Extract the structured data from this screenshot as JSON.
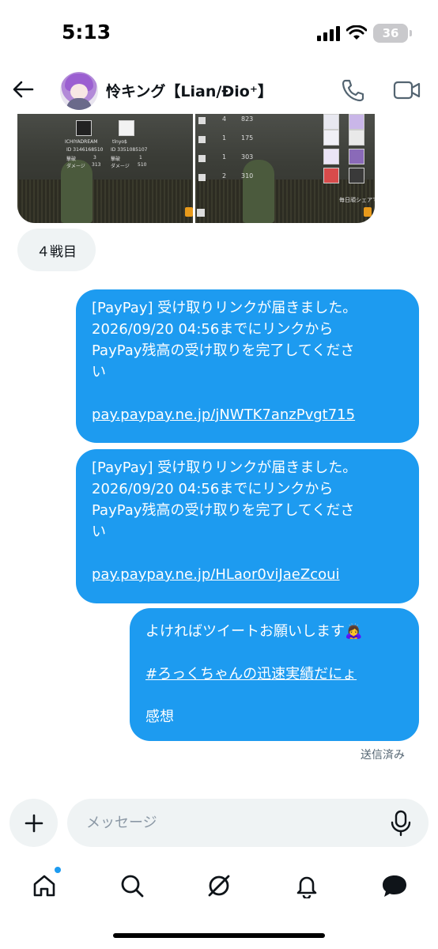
{
  "status_bar": {
    "time": "5:13",
    "battery": "36"
  },
  "header": {
    "contact_name": "怜キング【Lian/Đio⁺】"
  },
  "shared_images": {
    "left_card": {
      "players": [
        "ICHIYADREAM",
        "tlnyo$"
      ],
      "lines": [
        "ID 3146168510",
        "ID 3351085107",
        "撃破",
        "3",
        "撃破",
        "1",
        "ダメージ",
        "313",
        "ダメージ",
        "510"
      ]
    },
    "right_card": {
      "ranks": [
        "4",
        "1",
        "1",
        "2"
      ],
      "scores": [
        "823",
        "175",
        "303",
        "310"
      ],
      "footer": "毎日頑シェアで"
    }
  },
  "round_chip": "４戦目",
  "messages": [
    {
      "lines": [
        "[PayPay] 受け取りリンクが届きました。",
        "2026/09/20 04:56までにリンクから",
        "PayPay残高の受け取りを完了してくださ",
        "い"
      ],
      "link": "pay.paypay.ne.jp/jNWTK7anzPvgt715"
    },
    {
      "lines": [
        "[PayPay] 受け取りリンクが届きました。",
        "2026/09/20 04:56までにリンクから",
        "PayPay残高の受け取りを完了してくださ",
        "い"
      ],
      "link": "pay.paypay.ne.jp/HLaor0viJaeZcoui"
    },
    {
      "line1": "よければツイートお願いします🙇‍♀️",
      "hashtag": "#ろっくちゃんの迅速実績だにょ",
      "line3": "感想"
    }
  ],
  "sent_status": "送信済み",
  "composer": {
    "placeholder": "メッセージ"
  },
  "icons": {
    "back": "arrow-left-icon",
    "phone": "phone-icon",
    "video": "video-camera-icon",
    "plus": "plus-icon",
    "mic": "microphone-icon",
    "home": "home-icon",
    "search": "search-icon",
    "grok": "slash-circle-icon",
    "notifications": "bell-icon",
    "messages": "chat-bubble-icon"
  },
  "colors": {
    "accent": "#1d9bf0",
    "bubble_text": "#ffffff",
    "chip_bg": "#eff3f4"
  }
}
